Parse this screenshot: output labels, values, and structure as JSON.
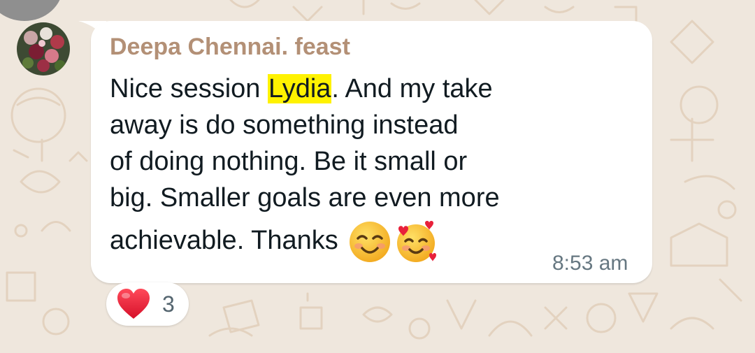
{
  "chat": {
    "background_color": "#efe7dd",
    "message": {
      "sender": "Deepa Chennai. feast",
      "sender_color": "#b39076",
      "lines": {
        "l1_before": "Nice session ",
        "mention": "Lydia",
        "l1_after": ". And my take",
        "l2": "away is do something instead",
        "l3": "of doing nothing. Be it small or",
        "l4": "big. Smaller goals are even more",
        "l5": "achievable. Thanks "
      },
      "mention_highlight_color": "#fff200",
      "emojis": [
        "smiling-face-icon",
        "smiling-face-with-hearts-icon"
      ],
      "time": "8:53 am"
    },
    "reaction": {
      "emoji": "heart-icon",
      "count": "3"
    }
  }
}
